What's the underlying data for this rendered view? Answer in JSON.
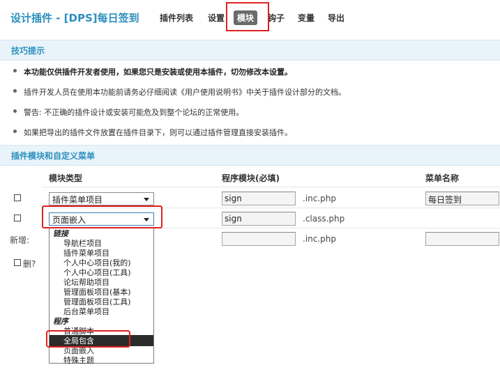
{
  "header": {
    "title": "设计插件 - [DPS]每日签到",
    "nav": [
      "插件列表",
      "设置",
      "模块",
      "钩子",
      "变量",
      "导出"
    ],
    "active_nav": "模块"
  },
  "tips_section": {
    "title": "技巧提示",
    "items": [
      "本功能仅供插件开发者使用，如果您只是安装或使用本插件，切勿修改本设置。",
      "插件开发人员在使用本功能前请务必仔细阅读《用户使用说明书》中关于插件设计部分的文档。",
      "警告: 不正确的插件设计或安装可能危及到整个论坛的正常使用。",
      "如果把导出的插件文件放置在插件目录下，则可以通过插件管理直接安装插件。"
    ]
  },
  "modules_section": {
    "title": "插件模块和自定义菜单",
    "columns": [
      "模块类型",
      "程序模块(必填)",
      "菜单名称"
    ],
    "rows": [
      {
        "type": "插件菜单项目",
        "module": "sign",
        "suffix": ".inc.php",
        "menu": "每日签到"
      },
      {
        "type": "页面嵌入",
        "module": "sign",
        "suffix": ".class.php",
        "menu": ""
      }
    ],
    "new_row": {
      "label": "新增:",
      "module": "",
      "suffix": ".inc.php",
      "menu": ""
    },
    "delete_label": "删?"
  },
  "dropdown": {
    "groups": [
      {
        "label": "链接",
        "items": [
          "导航栏项目",
          "插件菜单项目",
          "个人中心项目(我的)",
          "个人中心项目(工具)",
          "论坛帮助项目",
          "管理面板项目(基本)",
          "管理面板项目(工具)",
          "后台菜单项目"
        ]
      },
      {
        "label": "程序",
        "items": [
          "普通脚本",
          "全局包含",
          "页面嵌入",
          "特殊主题"
        ]
      }
    ],
    "selected": "全局包含"
  },
  "colors": {
    "accent": "#2b8fbd",
    "section_bg": "#e8f3fa",
    "highlight_red": "#e02020",
    "selected_bg": "#2b2b2b"
  }
}
